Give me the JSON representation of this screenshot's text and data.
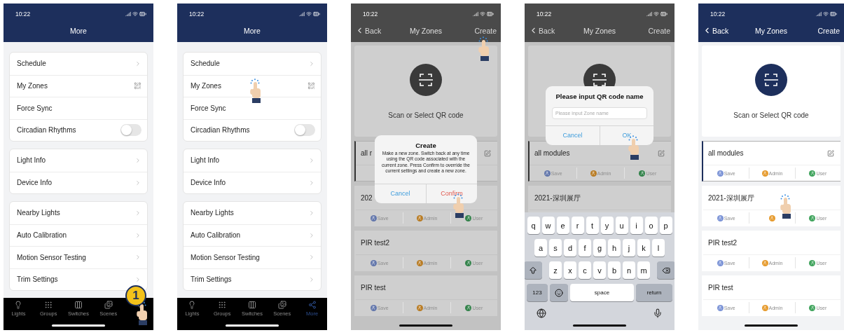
{
  "phones": [
    {
      "kind": "more",
      "time": "10:22",
      "nav": {
        "title": "More"
      },
      "step_badge": "1",
      "groups": [
        [
          {
            "kind": "link",
            "label": "Schedule"
          },
          {
            "kind": "qr",
            "label": "My Zones"
          },
          {
            "kind": "plain",
            "label": "Force Sync"
          },
          {
            "kind": "toggle",
            "label": "Circadian Rhythms",
            "on": false
          }
        ],
        [
          {
            "kind": "link",
            "label": "Light Info"
          },
          {
            "kind": "link",
            "label": "Device Info"
          }
        ],
        [
          {
            "kind": "link",
            "label": "Nearby Lights"
          },
          {
            "kind": "link",
            "label": "Auto Calibration"
          },
          {
            "kind": "link",
            "label": "Motion Sensor Testing"
          },
          {
            "kind": "link",
            "label": "Trim Settings"
          }
        ]
      ],
      "tabs": [
        {
          "label": "Lights",
          "selected": false,
          "tapped": false
        },
        {
          "label": "Groups",
          "selected": false,
          "tapped": false
        },
        {
          "label": "Switches",
          "selected": false,
          "tapped": false
        },
        {
          "label": "Scenes",
          "selected": false,
          "tapped": false
        },
        {
          "selected": false,
          "tapped": true
        }
      ]
    },
    {
      "kind": "more",
      "time": "10:22",
      "nav": {
        "title": "More"
      },
      "groups": [
        [
          {
            "kind": "link",
            "label": "Schedule",
            "tapped": false
          },
          {
            "kind": "qr",
            "label": "My Zones",
            "tapped": true
          },
          {
            "kind": "plain",
            "label": "Force Sync",
            "tapped": false
          },
          {
            "kind": "toggle",
            "label": "Circadian Rhythms",
            "on": false,
            "tapped": false
          }
        ],
        [
          {
            "kind": "link",
            "label": "Light Info"
          },
          {
            "kind": "link",
            "label": "Device Info"
          }
        ],
        [
          {
            "kind": "link",
            "label": "Nearby Lights"
          },
          {
            "kind": "link",
            "label": "Auto Calibration"
          },
          {
            "kind": "link",
            "label": "Motion Sensor Testing"
          },
          {
            "kind": "link",
            "label": "Trim Settings"
          }
        ]
      ],
      "tabs": [
        {
          "label": "Lights",
          "selected": false,
          "tapped": false
        },
        {
          "label": "Groups",
          "selected": false,
          "tapped": false
        },
        {
          "label": "Switches",
          "selected": false,
          "tapped": false
        },
        {
          "label": "Scenes",
          "selected": false,
          "tapped": false
        },
        {
          "label": "More",
          "selected": true,
          "tapped": false
        }
      ]
    },
    {
      "kind": "zones",
      "time": "10:22",
      "dimmed": true,
      "nav": {
        "back": "Back",
        "title": "My Zones",
        "action": {
          "label": "Create",
          "tapped": true
        }
      },
      "scan": {
        "label": "Scan or Select QR code"
      },
      "zones": [
        {
          "name": "all r",
          "selected": true,
          "edit": true
        },
        {
          "name": "202",
          "selected": false,
          "edit": false,
          "actions": [
            {
              "label": "Save",
              "color": "#6276ab"
            },
            {
              "label": "Admin",
              "color": "#b87b23"
            },
            {
              "label": "User",
              "color": "#32824a"
            }
          ]
        },
        {
          "name": "PIR test2",
          "selected": false,
          "edit": false,
          "actions": [
            {
              "label": "Save",
              "color": "#6276ab"
            },
            {
              "label": "Admin",
              "color": "#b87b23"
            },
            {
              "label": "User",
              "color": "#32824a"
            }
          ]
        },
        {
          "name": "PIR test",
          "selected": false,
          "edit": false,
          "actions": [
            {
              "label": "Save",
              "color": "#6276ab"
            },
            {
              "label": "Admin",
              "color": "#b87b23"
            },
            {
              "label": "User",
              "color": "#32824a"
            }
          ]
        }
      ],
      "dialog": {
        "kind": "confirm",
        "title": "Create",
        "message": "Make a new zone. Switch back at any time using the QR code associated with the current zone. Press Confirm to override the current settings and create a new zone.",
        "buttons": [
          {
            "kind": "cancel",
            "label": "Cancel",
            "tapped": false
          },
          {
            "kind": "destructive",
            "label": "Confirm",
            "tapped": true
          }
        ]
      }
    },
    {
      "kind": "zones",
      "time": "10:22",
      "dimmed": true,
      "nav": {
        "back": "Back",
        "title": "My Zones",
        "action": {
          "label": "Create",
          "tapped": false
        }
      },
      "zones": [
        {
          "name": "all modules",
          "selected": true,
          "edit": true,
          "actions": [
            {
              "label": "Save",
              "color": "#6276ab"
            },
            {
              "label": "Admin",
              "color": "#b87b23"
            },
            {
              "label": "User",
              "color": "#32824a"
            }
          ]
        },
        {
          "name": "2021-深圳展厅",
          "selected": false,
          "edit": false
        }
      ],
      "dialog": {
        "kind": "prompt",
        "title": "Please input QR code name",
        "placeholder": "Please input Zone name",
        "buttons": [
          {
            "kind": "cancel",
            "label": "Cancel",
            "tapped": false
          },
          {
            "kind": "default",
            "label": "OK",
            "tapped": true
          }
        ]
      },
      "keyboard": {
        "rows": [
          {
            "keys": [
              {
                "kind": "letter",
                "label": "q"
              },
              {
                "kind": "letter",
                "label": "w"
              },
              {
                "kind": "letter",
                "label": "e"
              },
              {
                "kind": "letter",
                "label": "r"
              },
              {
                "kind": "letter",
                "label": "t"
              },
              {
                "kind": "letter",
                "label": "y"
              },
              {
                "kind": "letter",
                "label": "u"
              },
              {
                "kind": "letter",
                "label": "i"
              },
              {
                "kind": "letter",
                "label": "o"
              },
              {
                "kind": "letter",
                "label": "p"
              }
            ]
          },
          {
            "keys": [
              {
                "kind": "letter",
                "label": "a"
              },
              {
                "kind": "letter",
                "label": "s"
              },
              {
                "kind": "letter",
                "label": "d"
              },
              {
                "kind": "letter",
                "label": "f"
              },
              {
                "kind": "letter",
                "label": "g"
              },
              {
                "kind": "letter",
                "label": "h"
              },
              {
                "kind": "letter",
                "label": "j"
              },
              {
                "kind": "letter",
                "label": "k"
              },
              {
                "kind": "letter",
                "label": "l"
              }
            ]
          },
          {
            "keys": [
              {
                "kind": "shift"
              },
              {
                "kind": "letter",
                "label": "z"
              },
              {
                "kind": "letter",
                "label": "x"
              },
              {
                "kind": "letter",
                "label": "c"
              },
              {
                "kind": "letter",
                "label": "v"
              },
              {
                "kind": "letter",
                "label": "b"
              },
              {
                "kind": "letter",
                "label": "n"
              },
              {
                "kind": "letter",
                "label": "m"
              },
              {
                "kind": "delete"
              }
            ]
          },
          {
            "keys": [
              {
                "kind": "mode",
                "label": "123"
              },
              {
                "kind": "emoji"
              },
              {
                "kind": "space",
                "label": "space"
              },
              {
                "kind": "return",
                "label": "return"
              }
            ]
          },
          {
            "keys": [
              {
                "kind": "globe"
              },
              {
                "kind": "mic"
              }
            ]
          }
        ]
      }
    },
    {
      "kind": "zones",
      "time": "10:22",
      "dimmed": false,
      "nav": {
        "back": "Back",
        "title": "My Zones",
        "action": {
          "label": "Create",
          "tapped": false
        }
      },
      "scan": {
        "label": "Scan or Select QR code"
      },
      "zones": [
        {
          "name": "all modules",
          "selected": true,
          "edit": true,
          "tapped": false,
          "actions": [
            {
              "label": "Save",
              "color": "#7b93d6"
            },
            {
              "label": "Admin",
              "color": "#e69a2c"
            },
            {
              "label": "User",
              "color": "#3fa35c"
            }
          ]
        },
        {
          "name": "2021-深圳展厅",
          "selected": false,
          "edit": false,
          "tapped": true,
          "actions": [
            {
              "label": "Save",
              "color": "#7b93d6"
            },
            {
              "color": "#e69a2c"
            },
            {
              "label": "User",
              "color": "#3fa35c"
            }
          ]
        },
        {
          "name": "PIR test2",
          "selected": false,
          "edit": false,
          "tapped": false,
          "actions": [
            {
              "label": "Save",
              "color": "#7b93d6"
            },
            {
              "label": "Admin",
              "color": "#e69a2c"
            },
            {
              "label": "User",
              "color": "#3fa35c"
            }
          ]
        },
        {
          "name": "PIR test",
          "selected": false,
          "edit": false,
          "tapped": false,
          "actions": [
            {
              "label": "Save",
              "color": "#7b93d6"
            },
            {
              "label": "Admin",
              "color": "#e69a2c"
            },
            {
              "label": "User",
              "color": "#3fa35c"
            }
          ]
        }
      ]
    }
  ]
}
